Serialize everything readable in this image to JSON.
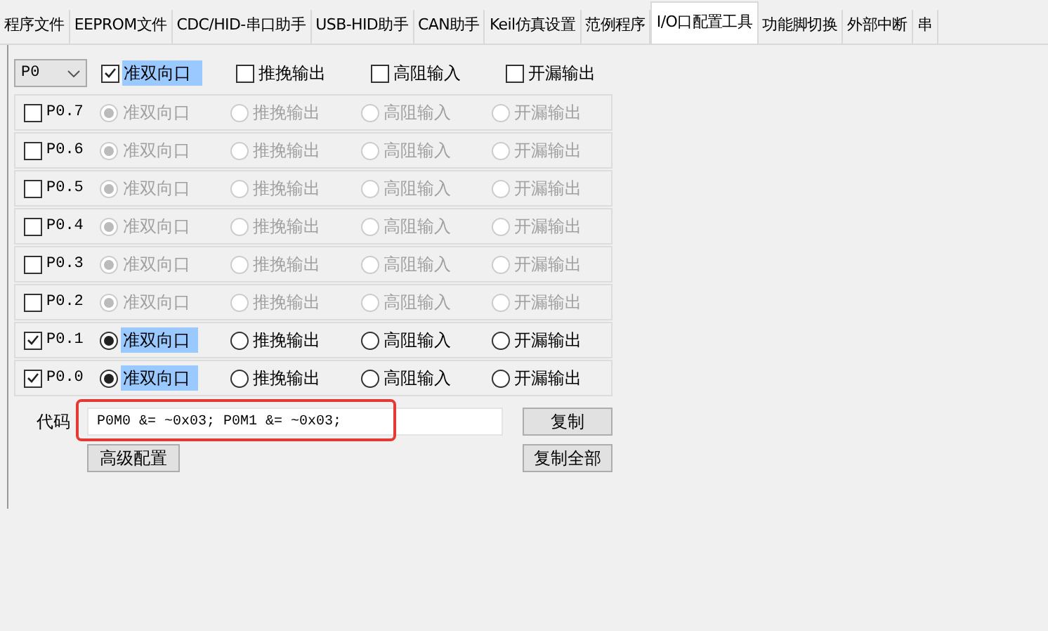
{
  "tabs": [
    {
      "label": "程序文件",
      "selected": false
    },
    {
      "label": "EEPROM文件",
      "selected": false
    },
    {
      "label": "CDC/HID-串口助手",
      "selected": false
    },
    {
      "label": "USB-HID助手",
      "selected": false
    },
    {
      "label": "CAN助手",
      "selected": false
    },
    {
      "label": "Keil仿真设置",
      "selected": false
    },
    {
      "label": "范例程序",
      "selected": false
    },
    {
      "label": "I/O口配置工具",
      "selected": true
    },
    {
      "label": "功能脚切换",
      "selected": false
    },
    {
      "label": "外部中断",
      "selected": false
    },
    {
      "label": "串",
      "selected": false
    }
  ],
  "port_select": {
    "value": "P0"
  },
  "header_options": [
    {
      "label": "准双向口",
      "checked": true,
      "selected": true
    },
    {
      "label": "推挽输出",
      "checked": false,
      "selected": false
    },
    {
      "label": "高阻输入",
      "checked": false,
      "selected": false
    },
    {
      "label": "开漏输出",
      "checked": false,
      "selected": false
    }
  ],
  "pins": [
    {
      "label": "P0.7",
      "checked": false,
      "options": [
        {
          "label": "准双向口",
          "selected": true
        },
        {
          "label": "推挽输出",
          "selected": false
        },
        {
          "label": "高阻输入",
          "selected": false
        },
        {
          "label": "开漏输出",
          "selected": false
        }
      ]
    },
    {
      "label": "P0.6",
      "checked": false,
      "options": [
        {
          "label": "准双向口",
          "selected": true
        },
        {
          "label": "推挽输出",
          "selected": false
        },
        {
          "label": "高阻输入",
          "selected": false
        },
        {
          "label": "开漏输出",
          "selected": false
        }
      ]
    },
    {
      "label": "P0.5",
      "checked": false,
      "options": [
        {
          "label": "准双向口",
          "selected": true
        },
        {
          "label": "推挽输出",
          "selected": false
        },
        {
          "label": "高阻输入",
          "selected": false
        },
        {
          "label": "开漏输出",
          "selected": false
        }
      ]
    },
    {
      "label": "P0.4",
      "checked": false,
      "options": [
        {
          "label": "准双向口",
          "selected": true
        },
        {
          "label": "推挽输出",
          "selected": false
        },
        {
          "label": "高阻输入",
          "selected": false
        },
        {
          "label": "开漏输出",
          "selected": false
        }
      ]
    },
    {
      "label": "P0.3",
      "checked": false,
      "options": [
        {
          "label": "准双向口",
          "selected": true
        },
        {
          "label": "推挽输出",
          "selected": false
        },
        {
          "label": "高阻输入",
          "selected": false
        },
        {
          "label": "开漏输出",
          "selected": false
        }
      ]
    },
    {
      "label": "P0.2",
      "checked": false,
      "options": [
        {
          "label": "准双向口",
          "selected": true
        },
        {
          "label": "推挽输出",
          "selected": false
        },
        {
          "label": "高阻输入",
          "selected": false
        },
        {
          "label": "开漏输出",
          "selected": false
        }
      ]
    },
    {
      "label": "P0.1",
      "checked": true,
      "options": [
        {
          "label": "准双向口",
          "selected": true
        },
        {
          "label": "推挽输出",
          "selected": false
        },
        {
          "label": "高阻输入",
          "selected": false
        },
        {
          "label": "开漏输出",
          "selected": false
        }
      ]
    },
    {
      "label": "P0.0",
      "checked": true,
      "options": [
        {
          "label": "准双向口",
          "selected": true
        },
        {
          "label": "推挽输出",
          "selected": false
        },
        {
          "label": "高阻输入",
          "selected": false
        },
        {
          "label": "开漏输出",
          "selected": false
        }
      ]
    }
  ],
  "code": {
    "label": "代码",
    "value": "P0M0 &= ~0x03; P0M1 &= ~0x03;"
  },
  "buttons": {
    "copy": "复制",
    "advanced": "高级配置",
    "copy_all": "复制全部"
  }
}
